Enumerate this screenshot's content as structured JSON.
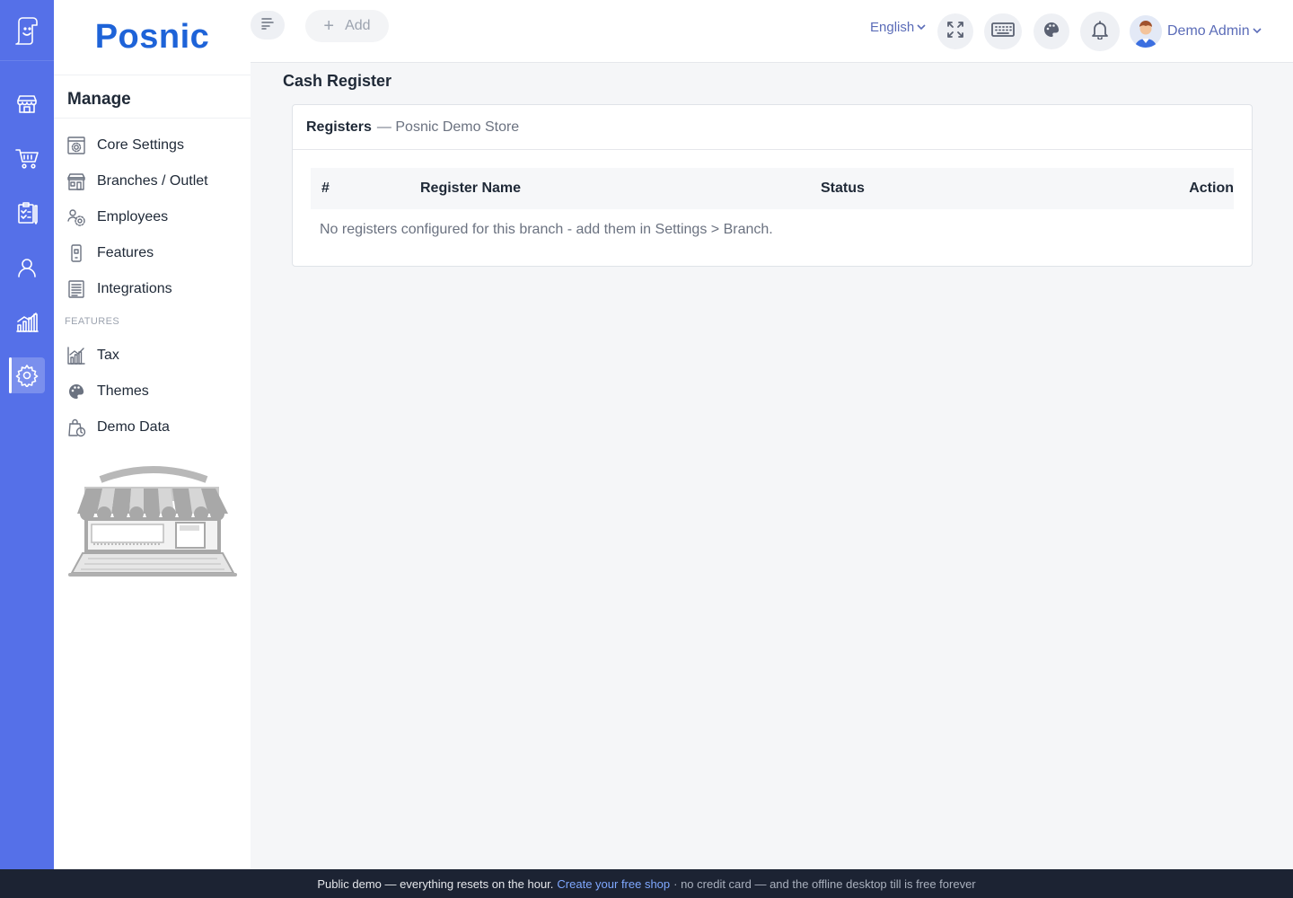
{
  "brand": {
    "name": "Posnic",
    "color": "#1e63d8"
  },
  "rail": {
    "color": "#5570e8",
    "items": [
      {
        "icon": "store-icon"
      },
      {
        "icon": "cart-icon"
      },
      {
        "icon": "clipboard-icon"
      },
      {
        "icon": "user-icon"
      },
      {
        "icon": "analytics-icon"
      },
      {
        "icon": "gear-icon",
        "active": true
      }
    ]
  },
  "sidebar": {
    "heading": "Manage",
    "items": [
      {
        "label": "Core Settings",
        "icon": "settings-panel-icon"
      },
      {
        "label": "Branches / Outlet",
        "icon": "storefront-icon"
      },
      {
        "label": "Employees",
        "icon": "employees-gear-icon"
      },
      {
        "label": "Features",
        "icon": "device-icon"
      },
      {
        "label": "Integrations",
        "icon": "document-list-icon"
      }
    ],
    "section_label": "FEATURES",
    "feature_items": [
      {
        "label": "Tax",
        "icon": "tax-chart-icon"
      },
      {
        "label": "Themes",
        "icon": "palette-icon"
      },
      {
        "label": "Demo Data",
        "icon": "bag-clock-icon"
      }
    ]
  },
  "topbar": {
    "add_label": "Add",
    "language": "English",
    "user_name": "Demo Admin"
  },
  "main": {
    "page_title": "Cash Register",
    "card_title": "Registers",
    "card_subtitle": "— Posnic Demo Store",
    "columns": [
      "#",
      "Register Name",
      "Status",
      "Action"
    ],
    "empty_message": "No registers configured for this branch - add them in Settings > Branch."
  },
  "footer": {
    "lead": "Public demo — everything resets on the hour.",
    "link": "Create your free shop",
    "tail": "· no credit card — and the offline desktop till is free forever"
  }
}
